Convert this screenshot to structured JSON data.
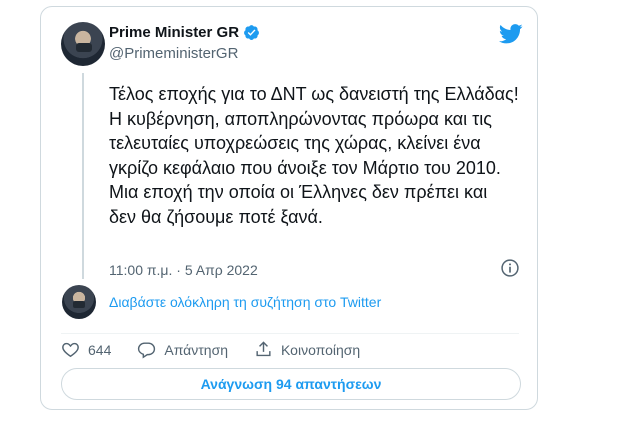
{
  "author": {
    "display_name": "Prime Minister GR",
    "handle": "@PrimeministerGR",
    "verified": true
  },
  "tweet": {
    "text": "Τέλος εποχής για το ΔΝΤ ως δανειστή της Ελλάδας! Η κυβέρνηση, αποπληρώνοντας πρόωρα και τις τελευταίες υποχρεώσεις της χώρας, κλείνει ένα γκρίζο κεφάλαιο που άνοιξε τον Μάρτιο του 2010. Μια εποχή την οποία οι Έλληνες δεν πρέπει και δεν θα ζήσουμε ποτέ ξανά.",
    "timestamp": "11:00 π.μ. · 5 Απρ 2022"
  },
  "thread": {
    "read_link": "Διαβάστε ολόκληρη τη συζήτηση στο Twitter"
  },
  "actions": {
    "like_count": "644",
    "reply_label": "Απάντηση",
    "share_label": "Κοινοποίηση"
  },
  "replies_button": "Ανάγνωση 94 απαντήσεων",
  "colors": {
    "accent": "#1d9bf0",
    "text": "#0f1419",
    "secondary": "#536471",
    "border": "#cfd9de"
  },
  "icons": [
    "verified-badge-icon",
    "twitter-bird-icon",
    "info-icon",
    "heart-icon",
    "reply-icon",
    "share-icon"
  ]
}
